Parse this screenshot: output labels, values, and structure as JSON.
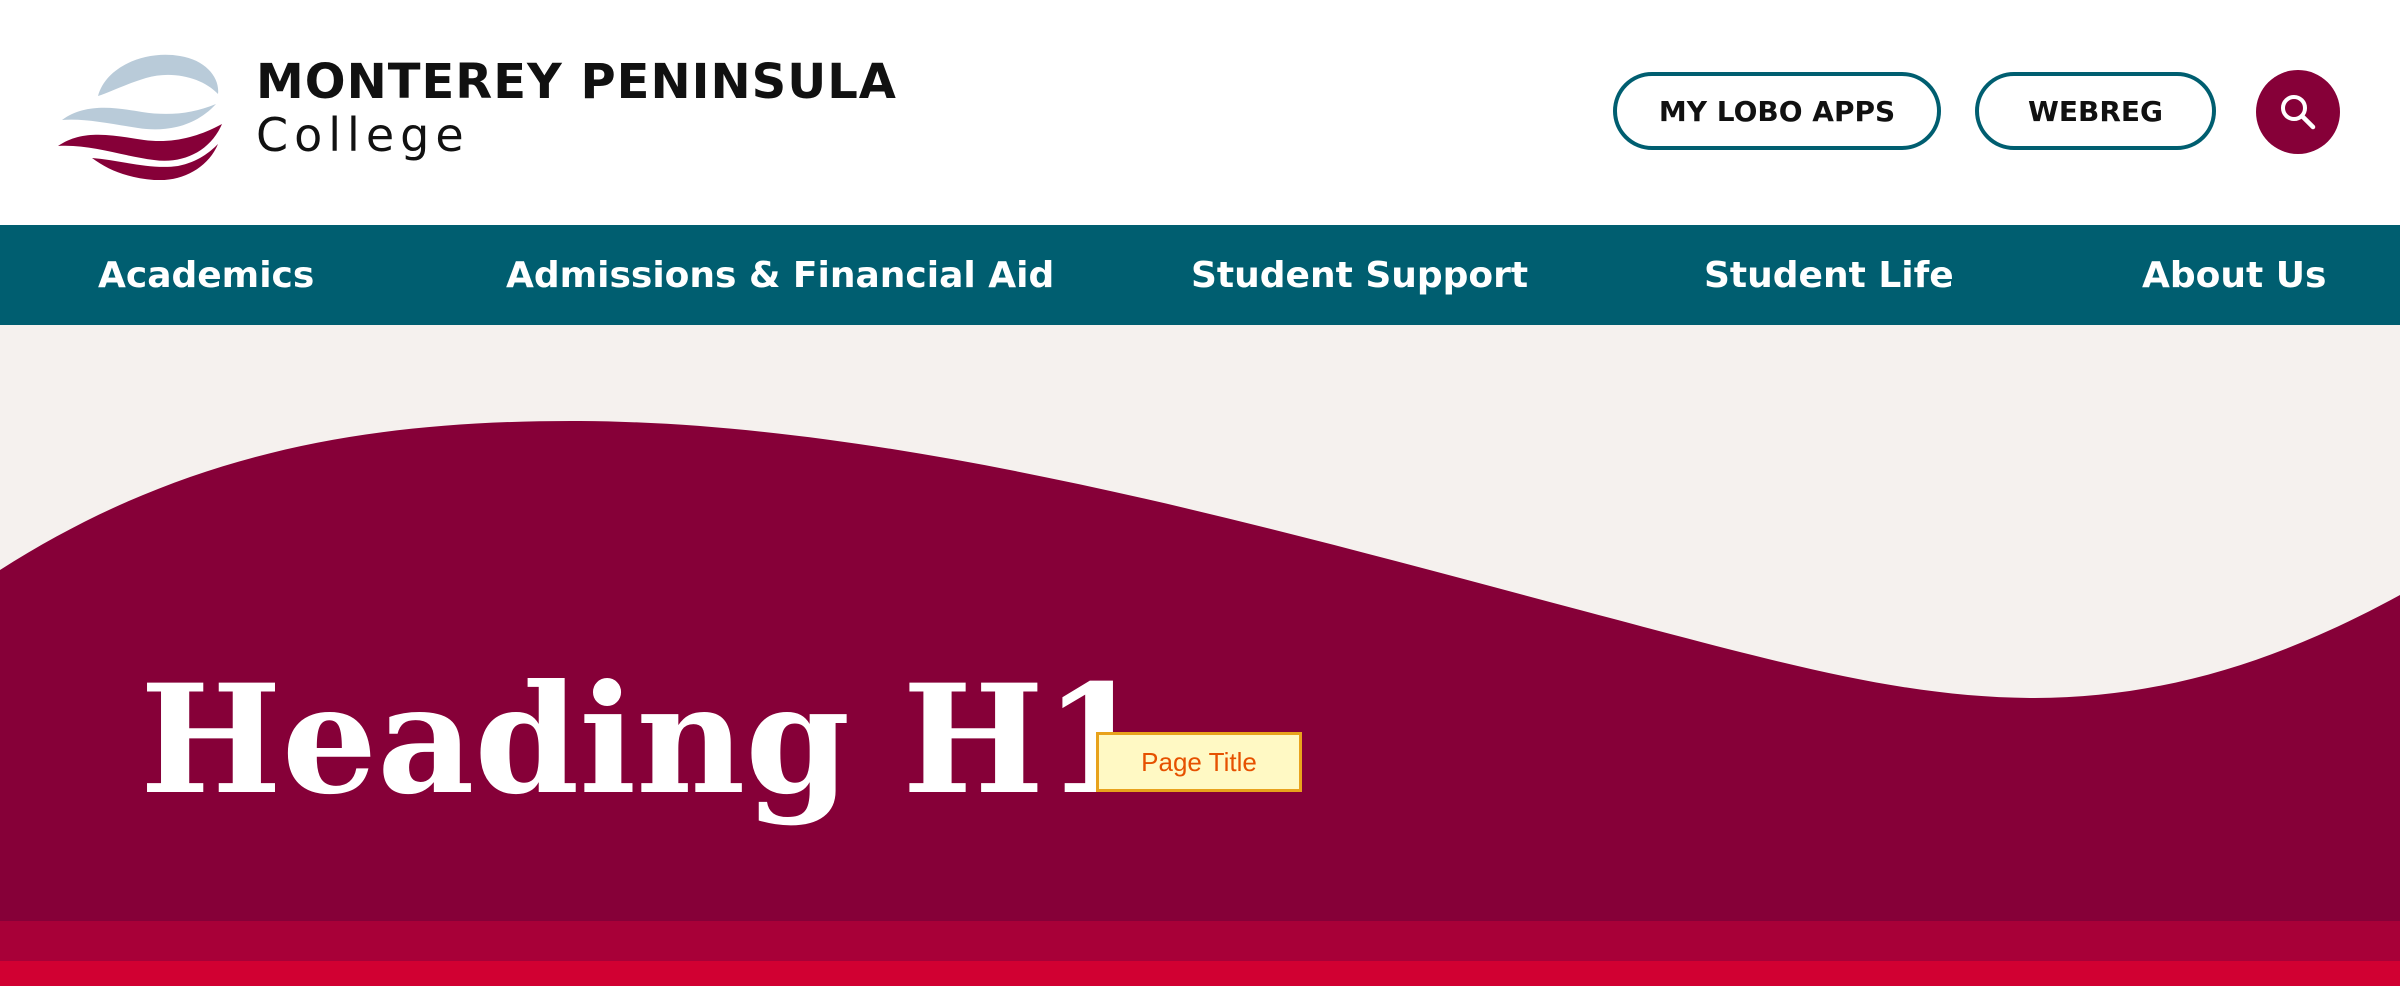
{
  "brand": {
    "name_line1": "MONTEREY PENINSULA",
    "name_line2": "College",
    "colors": {
      "primary_teal": "#005e70",
      "maroon": "#860038",
      "logo_blue_gray": "#b9cbd9",
      "hero_background": "#f5f1ee",
      "stripe_red_dark": "#a80038",
      "stripe_red_bright": "#d10032"
    }
  },
  "header": {
    "buttons": [
      {
        "label": "MY LOBO APPS"
      },
      {
        "label": "WEBREG"
      }
    ],
    "search": {
      "icon": "search-icon"
    }
  },
  "nav": {
    "items": [
      {
        "label": "Academics"
      },
      {
        "label": "Admissions & Financial Aid"
      },
      {
        "label": "Student Support"
      },
      {
        "label": "Student Life"
      },
      {
        "label": "About Us"
      }
    ]
  },
  "hero": {
    "heading": "Heading H1",
    "tag_label": "Page Title"
  }
}
